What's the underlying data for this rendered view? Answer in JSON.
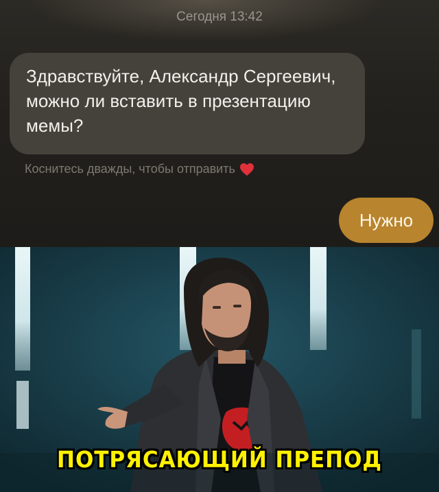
{
  "chat": {
    "timestamp": "Сегодня 13:42",
    "incoming_message": "Здравствуйте, Александр Сергеевич, можно ли вставить в презентацию мемы?",
    "double_tap_hint": "Коснитесь дважды, чтобы отправить",
    "outgoing_message": "Нужно",
    "colors": {
      "incoming_bubble": "#45423c",
      "outgoing_bubble": "#b8842e",
      "heart": "#e0313b"
    }
  },
  "meme": {
    "caption": "ПОТРЯСАЮЩИЙ ПРЕПОД",
    "caption_color": "#fff200"
  }
}
